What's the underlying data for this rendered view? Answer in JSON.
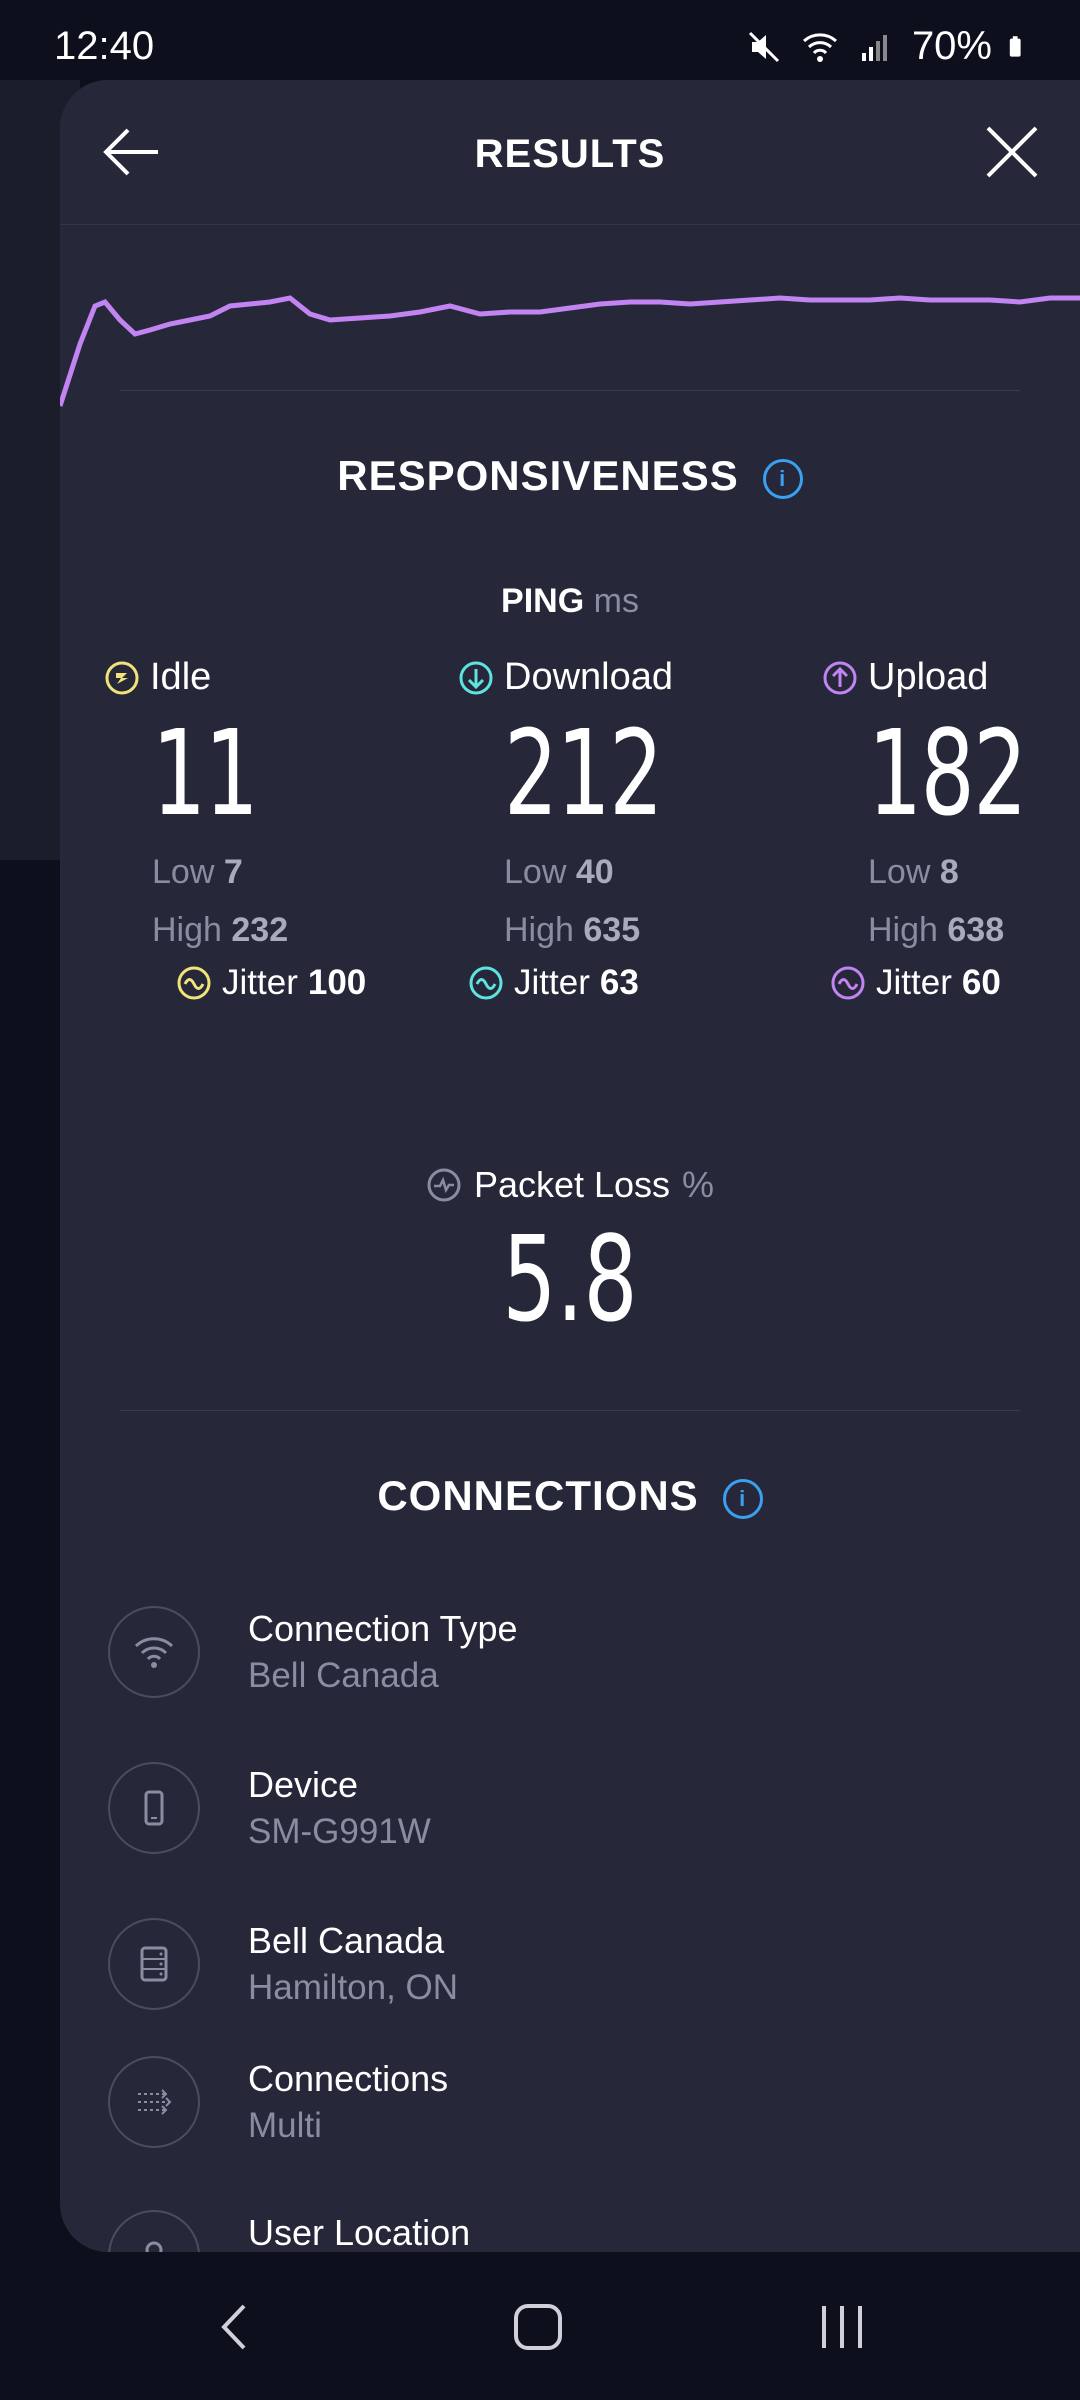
{
  "status_bar": {
    "time": "12:40",
    "battery": "70%",
    "icons": [
      "mute-icon",
      "wifi-icon",
      "signal-icon",
      "battery-icon"
    ]
  },
  "header": {
    "title": "RESULTS",
    "back_icon": "back-arrow-icon",
    "close_icon": "close-icon"
  },
  "responsiveness": {
    "title": "RESPONSIVENESS",
    "ping_label": "PING",
    "ping_unit": "ms",
    "columns": [
      {
        "label": "Idle",
        "value": "11",
        "low_label": "Low",
        "low": "7",
        "high_label": "High",
        "high": "232",
        "jitter_label": "Jitter",
        "jitter": "100",
        "color": "#f2e27a"
      },
      {
        "label": "Download",
        "value": "212",
        "low_label": "Low",
        "low": "40",
        "high_label": "High",
        "high": "635",
        "jitter_label": "Jitter",
        "jitter": "63",
        "color": "#5fe3e0"
      },
      {
        "label": "Upload",
        "value": "182",
        "low_label": "Low",
        "low": "8",
        "high_label": "High",
        "high": "638",
        "jitter_label": "Jitter",
        "jitter": "60",
        "color": "#c184f2"
      }
    ],
    "packet_loss_label": "Packet Loss",
    "packet_loss_unit": "%",
    "packet_loss_value": "5.8"
  },
  "connections": {
    "title": "CONNECTIONS",
    "items": [
      {
        "label": "Connection Type",
        "value": "Bell Canada",
        "icon": "wifi-icon"
      },
      {
        "label": "Device",
        "value": "SM-G991W",
        "icon": "phone-icon"
      },
      {
        "label": "Bell Canada",
        "value": "Hamilton, ON",
        "icon": "server-icon"
      },
      {
        "label": "Connections",
        "value": "Multi",
        "icon": "multi-connection-icon"
      },
      {
        "label": "User Location",
        "value": "",
        "icon": "location-icon"
      }
    ]
  },
  "colors": {
    "accent_blue": "#3aa0f0",
    "graph_line": "#c184f2",
    "sheet_bg": "#262839"
  }
}
